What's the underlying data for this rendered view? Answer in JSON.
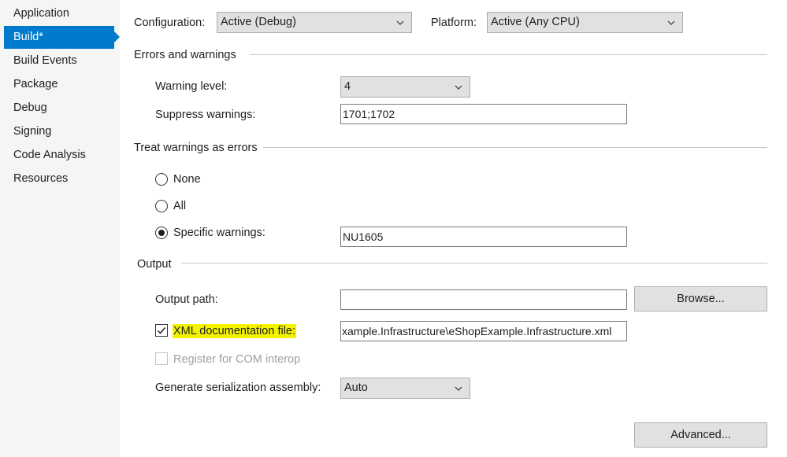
{
  "sidebar": {
    "items": [
      {
        "label": "Application"
      },
      {
        "label": "Build*"
      },
      {
        "label": "Build Events"
      },
      {
        "label": "Package"
      },
      {
        "label": "Debug"
      },
      {
        "label": "Signing"
      },
      {
        "label": "Code Analysis"
      },
      {
        "label": "Resources"
      }
    ],
    "active_index": 1
  },
  "header": {
    "configuration_label": "Configuration:",
    "configuration_value": "Active (Debug)",
    "platform_label": "Platform:",
    "platform_value": "Active (Any CPU)"
  },
  "errors_warnings": {
    "title": "Errors and warnings",
    "warning_level_label": "Warning level:",
    "warning_level_value": "4",
    "suppress_label": "Suppress warnings:",
    "suppress_value": "1701;1702"
  },
  "treat_warnings": {
    "title": "Treat warnings as errors",
    "none_label": "None",
    "all_label": "All",
    "specific_label": "Specific warnings:",
    "specific_value": "NU1605",
    "selected": "specific"
  },
  "output": {
    "title": "Output",
    "output_path_label": "Output path:",
    "output_path_value": "",
    "browse_label": "Browse...",
    "xml_doc_label": "XML documentation file:",
    "xml_doc_checked": true,
    "xml_doc_value": "xample.Infrastructure\\eShopExample.Infrastructure.xml",
    "com_interop_label": "Register for COM interop",
    "com_interop_checked": false,
    "com_interop_enabled": false,
    "serialization_label": "Generate serialization assembly:",
    "serialization_value": "Auto",
    "advanced_label": "Advanced..."
  },
  "colors": {
    "accent": "#007acc",
    "highlight": "#f3f300",
    "sidebar_bg": "#f5f5f5"
  },
  "icons": {
    "dropdown": "chevron-down-icon",
    "check": "checkmark-icon"
  }
}
